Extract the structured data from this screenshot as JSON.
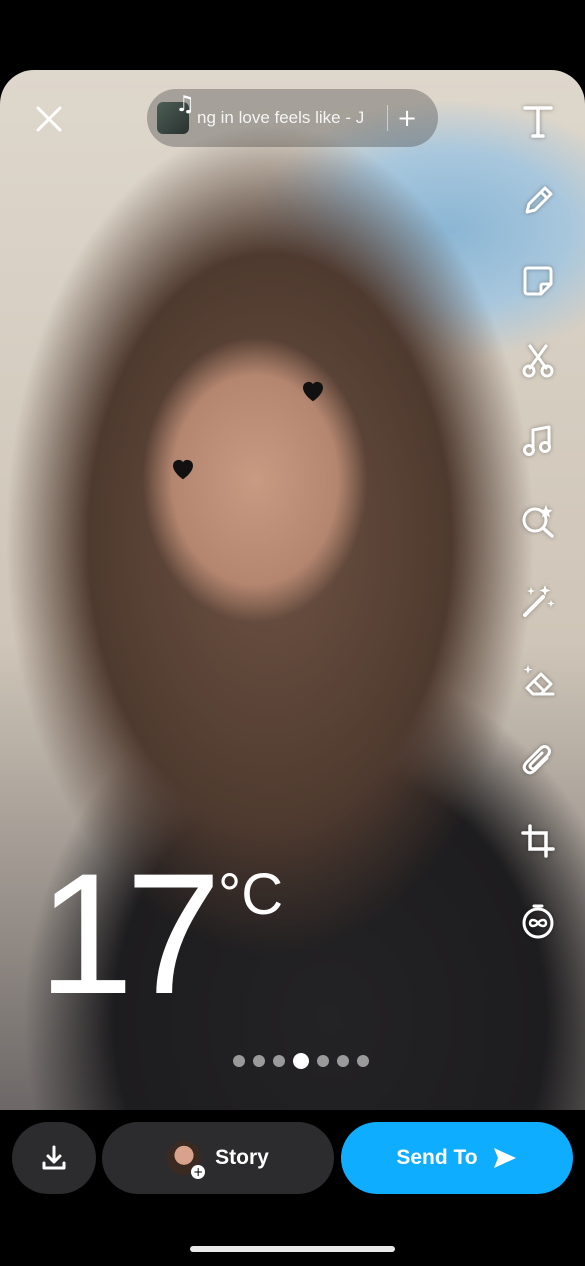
{
  "music": {
    "title": "ng in love feels like - J",
    "add_label": "+"
  },
  "sticker": {
    "temperature": "17",
    "unit": "°C"
  },
  "tools": [
    "text-icon",
    "pencil-icon",
    "sticker-icon",
    "scissors-icon",
    "music-icon",
    "lens-icon",
    "magic-wand-icon",
    "eraser-icon",
    "paperclip-icon",
    "crop-icon",
    "timer-icon"
  ],
  "pager": {
    "count": 7,
    "active_index": 3
  },
  "bottom": {
    "story_label": "Story",
    "send_label": "Send To"
  },
  "colors": {
    "send_button": "#0fadff",
    "dark_button": "#2c2c2e"
  }
}
